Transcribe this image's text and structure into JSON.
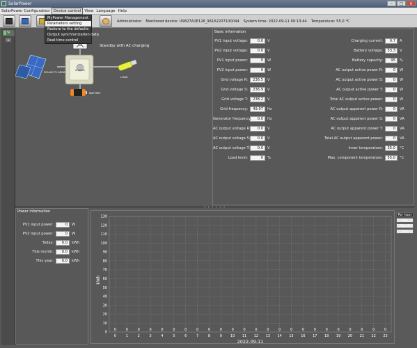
{
  "window": {
    "title": "SolarPower"
  },
  "menu": [
    "SolarPower Configuration",
    "Device control",
    "View",
    "Language",
    "Help"
  ],
  "menu_active_index": 1,
  "device_control_menu": [
    "MyPower Management",
    "Parameters setting",
    "Restore to the defaults",
    "Output synchronization data",
    "Real-time control"
  ],
  "device_control_highlight": 1,
  "status": {
    "user": "Administrator",
    "monitored_label": "Monitored device:",
    "monitored_value": "USB27A1E126_96162207100044",
    "time_label": "System time:",
    "time_value": "2022-09-11 00:13:44",
    "temp_label": "Temperature:",
    "temp_value": "55.0",
    "temp_unit": "°C"
  },
  "left_tree": {
    "item_label": "SI"
  },
  "diagram": {
    "status_text": "Standby with AC charging",
    "solar_label": "SOLAR PV ARRAY",
    "inverter_label": "Inverter",
    "load_label": "LOAD",
    "battery_label": "BATTERY"
  },
  "basic_info": {
    "title": "Basic information",
    "left": [
      {
        "label": "PV1 input voltage:",
        "value": "0.0",
        "unit": "V"
      },
      {
        "label": "PV2 input voltage:",
        "value": "0.0",
        "unit": "V"
      },
      {
        "label": "PV1 input power:",
        "value": "0",
        "unit": "W"
      },
      {
        "label": "PV2 input power:",
        "value": "0",
        "unit": "W"
      },
      {
        "label": "Grid voltage R:",
        "value": "236.5",
        "unit": "V"
      },
      {
        "label": "Grid voltage S:",
        "value": "236.9",
        "unit": "V"
      },
      {
        "label": "Grid voltage T:",
        "value": "238.2",
        "unit": "V"
      },
      {
        "label": "Grid frequency:",
        "value": "49.97",
        "unit": "Hz"
      },
      {
        "label": "Generator frequency:",
        "value": "0.0",
        "unit": "Hz"
      },
      {
        "label": "AC output voltage R:",
        "value": "0.0",
        "unit": "V"
      },
      {
        "label": "AC output voltage S:",
        "value": "0.0",
        "unit": "V"
      },
      {
        "label": "AC output voltage T:",
        "value": "0.0",
        "unit": "V"
      },
      {
        "label": "Load level:",
        "value": "0",
        "unit": "%"
      }
    ],
    "right": [
      {
        "label": "Charging current:",
        "value": "0.7",
        "unit": "A"
      },
      {
        "label": "Battery voltage:",
        "value": "53.3",
        "unit": "V"
      },
      {
        "label": "Battery capacity:",
        "value": "95",
        "unit": "%"
      },
      {
        "label": "AC output active power R:",
        "value": "0",
        "unit": "W"
      },
      {
        "label": "AC output active power S:",
        "value": "0",
        "unit": "W"
      },
      {
        "label": "AC output active power T:",
        "value": "0",
        "unit": "W"
      },
      {
        "label": "Total AC output active power:",
        "value": "0",
        "unit": "W"
      },
      {
        "label": "AC output apparent power R:",
        "value": "0",
        "unit": "VA"
      },
      {
        "label": "AC output apparent power S:",
        "value": "0",
        "unit": "VA"
      },
      {
        "label": "AC output apparent power T:",
        "value": "0",
        "unit": "VA"
      },
      {
        "label": "Total AC output apparent power:",
        "value": "0",
        "unit": "VA"
      },
      {
        "label": "Inner temperature:",
        "value": "35.0",
        "unit": "°C"
      },
      {
        "label": "Max. component temperature:",
        "value": "55.0",
        "unit": "°C"
      }
    ]
  },
  "power_info": {
    "title": "Power information",
    "rows": [
      {
        "label": "PV1 input power:",
        "value": "0",
        "unit": "W"
      },
      {
        "label": "PV2 input power:",
        "value": "0",
        "unit": "W"
      },
      {
        "label": "Today:",
        "value": "0.0",
        "unit": "kWh"
      },
      {
        "label": "This month:",
        "value": "0.0",
        "unit": "kWh"
      },
      {
        "label": "This year:",
        "value": "0.0",
        "unit": "kWh"
      }
    ]
  },
  "range_buttons": {
    "active": "Per hour",
    "others": [
      "Day",
      "Month",
      "Year"
    ]
  },
  "chart_data": {
    "type": "bar",
    "categories": [
      "0",
      "1",
      "2",
      "3",
      "4",
      "5",
      "6",
      "7",
      "8",
      "9",
      "10",
      "11",
      "12",
      "13",
      "14",
      "15",
      "16",
      "17",
      "18",
      "19",
      "20",
      "21",
      "22",
      "23"
    ],
    "values": [
      0,
      0,
      0,
      0,
      0,
      0,
      0,
      0,
      0,
      0,
      0,
      0,
      0,
      0,
      0,
      0,
      0,
      0,
      0,
      0,
      0,
      0,
      0,
      0
    ],
    "title": "",
    "xlabel": "2022-09-11",
    "ylabel": "kWh",
    "ylim": [
      0,
      130
    ],
    "yticks": [
      0,
      10,
      20,
      30,
      40,
      50,
      60,
      70,
      80,
      90,
      100,
      110,
      120,
      130
    ],
    "grid": true
  }
}
